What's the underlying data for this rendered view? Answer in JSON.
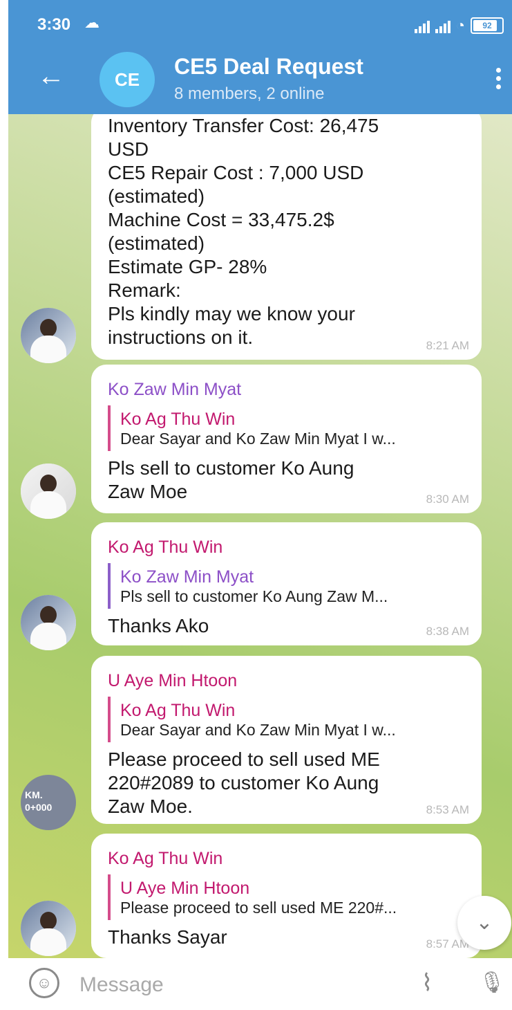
{
  "status_bar": {
    "time": "3:30",
    "battery": "92"
  },
  "header": {
    "avatar_initials": "CE",
    "title": "CE5 Deal Request",
    "subtitle": "8 members, 2 online"
  },
  "messages": [
    {
      "text": "Inventory Transfer Cost: 26,475\nUSD\nCE5 Repair Cost : 7,000 USD\n(estimated)\nMachine Cost = 33,475.2$\n(estimated)\nEstimate GP- 28%\nRemark:\nPls kindly may we know your\ninstructions on it.",
      "time": "8:21 AM"
    },
    {
      "sender": "Ko Zaw Min Myat",
      "reply_name": "Ko Ag Thu Win",
      "reply_text": "Dear Sayar and Ko Zaw Min Myat  I w...",
      "text": "Pls sell to customer  Ko Aung\nZaw Moe",
      "time": "8:30 AM"
    },
    {
      "sender": "Ko Ag Thu Win",
      "reply_name": "Ko Zaw Min Myat",
      "reply_text": "Pls sell to customer  Ko Aung Zaw M...",
      "text": "Thanks Ako",
      "time": "8:38 AM"
    },
    {
      "sender": "U Aye Min Htoon",
      "reply_name": "Ko Ag Thu Win",
      "reply_text": "Dear Sayar and Ko Zaw Min Myat  I w...",
      "text": "Please proceed to sell used ME\n220#2089 to customer Ko Aung\nZaw Moe.",
      "time": "8:53 AM",
      "avatar_text": "KM.\n0+000"
    },
    {
      "sender": "Ko Ag Thu Win",
      "reply_name": "U Aye Min Htoon",
      "reply_text": "Please proceed to sell used ME 220#...",
      "text": "Thanks Sayar",
      "time": "8:57 AM"
    }
  ],
  "input": {
    "placeholder": "Message"
  },
  "icons": {
    "back": "back-arrow-icon",
    "menu": "more-vert-icon",
    "emoji": "emoji-icon",
    "attach": "paperclip-icon",
    "mic": "microphone-icon",
    "scroll": "chevron-down-icon"
  },
  "colors": {
    "header": "#4a95d4",
    "avatar": "#5bc2f2",
    "sender_purple": "#8c4fc7",
    "sender_magenta": "#c2196e"
  }
}
